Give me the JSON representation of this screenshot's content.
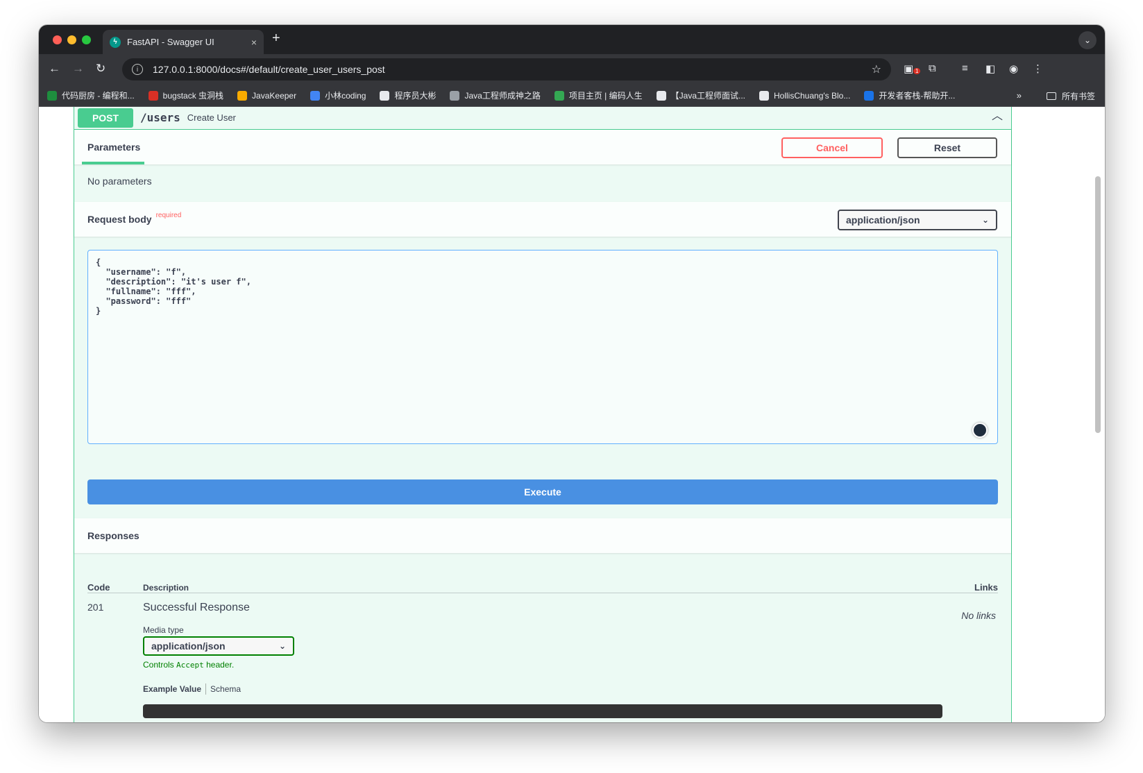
{
  "browser": {
    "tab_title": "FastAPI - Swagger UI",
    "tab_close": "×",
    "new_tab": "+",
    "url": "127.0.0.1:8000/docs#/default/create_user_users_post",
    "extension_badge": "1",
    "bookmarks": [
      {
        "label": "代码厨房 - 编程和...",
        "color": "#1e8e3e"
      },
      {
        "label": "bugstack 虫洞栈",
        "color": "#d93025"
      },
      {
        "label": "JavaKeeper",
        "color": "#f9ab00"
      },
      {
        "label": "小林coding",
        "color": "#4285f4"
      },
      {
        "label": "程序员大彬",
        "color": "#e8eaed"
      },
      {
        "label": "Java工程师成神之路",
        "color": "#9aa0a6"
      },
      {
        "label": "项目主页 | 编码人生",
        "color": "#34a853"
      },
      {
        "label": "【Java工程师面试...",
        "color": "#e8eaed"
      },
      {
        "label": "HollisChuang's Blo...",
        "color": "#e8eaed"
      },
      {
        "label": "开发者客栈-帮助开...",
        "color": "#1a73e8"
      }
    ],
    "bookmarks_more": "»",
    "all_bookmarks": "所有书签"
  },
  "operation": {
    "method": "POST",
    "path": "/users",
    "summary": "Create User"
  },
  "parameters": {
    "tab_label": "Parameters",
    "cancel_label": "Cancel",
    "reset_label": "Reset",
    "empty_text": "No parameters"
  },
  "request_body": {
    "title": "Request body",
    "required_label": "required",
    "content_type": "application/json",
    "body": "{\n  \"username\": \"f\",\n  \"description\": \"it's user f\",\n  \"fullname\": \"fff\",\n  \"password\": \"fff\"\n}"
  },
  "execute_label": "Execute",
  "responses": {
    "title": "Responses",
    "headers": {
      "code": "Code",
      "description": "Description",
      "links": "Links"
    },
    "rows": [
      {
        "code": "201",
        "description": "Successful Response",
        "links": "No links"
      }
    ],
    "media_type_label": "Media type",
    "media_type_value": "application/json",
    "controls_prefix": "Controls ",
    "controls_code": "Accept",
    "controls_suffix": " header.",
    "example_tab": "Example Value",
    "schema_tab": "Schema"
  },
  "colors": {
    "post": "#49cc90",
    "execute": "#4990e2",
    "cancel": "#ff6060"
  }
}
